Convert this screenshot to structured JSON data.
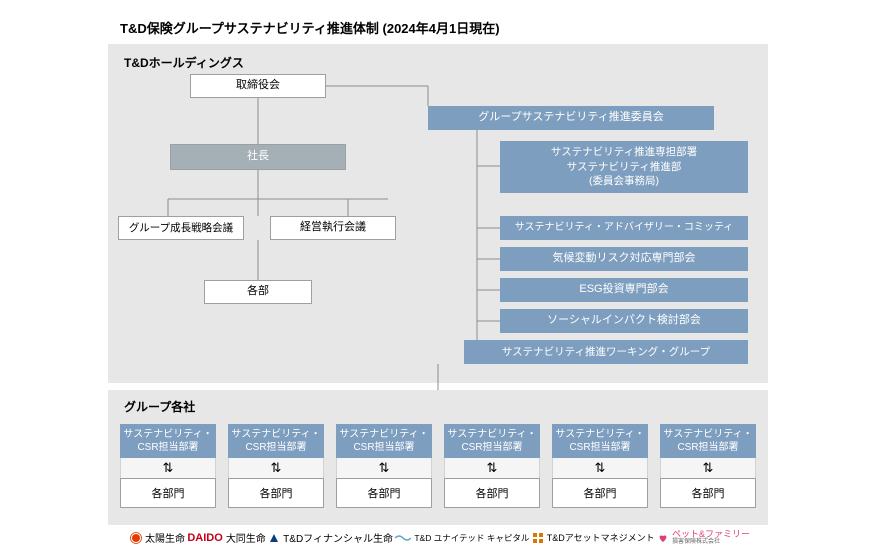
{
  "title": "T&D保険グループサステナビリティ推進体制 (2024年4月1日現在)",
  "topPanel": {
    "label": "T&Dホールディングス"
  },
  "org": {
    "board": "取締役会",
    "president": "社長",
    "growthCouncil": "グループ成長戦略会議",
    "execCouncil": "経営執行会議",
    "depts": "各部",
    "committee": "グループサステナビリティ推進委員会",
    "rightItems": {
      "r1_line1": "サステナビリティ推進専担部署",
      "r1_line2": "サステナビリティ推進部",
      "r1_line3": "(委員会事務局)",
      "r2": "サステナビリティ・アドバイザリー・コミッティ",
      "r3": "気候変動リスク対応専門部会",
      "r4": "ESG投資専門部会",
      "r5": "ソーシャルインパクト検討部会",
      "r6": "サステナビリティ推進ワーキング・グループ"
    }
  },
  "bottomPanel": {
    "label": "グループ各社"
  },
  "sub": {
    "head_line1": "サステナビリティ・",
    "head_line2": "CSR担当部署",
    "arrow": "⇅",
    "dept": "各部門"
  },
  "logos": {
    "taiyo": "太陽生命",
    "daido_logo": "DAIDO",
    "daido": "大同生命",
    "tdfinancial": "T&Dフィナンシャル生命",
    "tdunited": "T&D ユナイテッド キャピタル",
    "tdasset": "T&Dアセットマネジメント",
    "petfamily": "ペット&ファミリー",
    "petfamily_sub": "損害保険株式会社"
  }
}
